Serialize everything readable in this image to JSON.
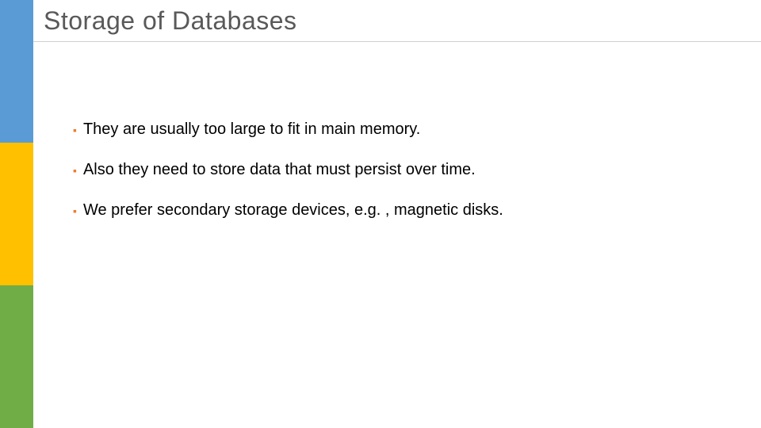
{
  "title": "Storage of Databases",
  "colors": {
    "blue": "#5B9BD5",
    "yellow": "#FFC000",
    "green": "#70AD47",
    "bullet": "#ED7D31",
    "title": "#595959"
  },
  "bullets": [
    {
      "text": "They are usually too large to fit in main memory."
    },
    {
      "text": "Also they need to store data that must persist over time."
    },
    {
      "text": "We prefer secondary storage devices, e.g. , magnetic disks."
    }
  ]
}
